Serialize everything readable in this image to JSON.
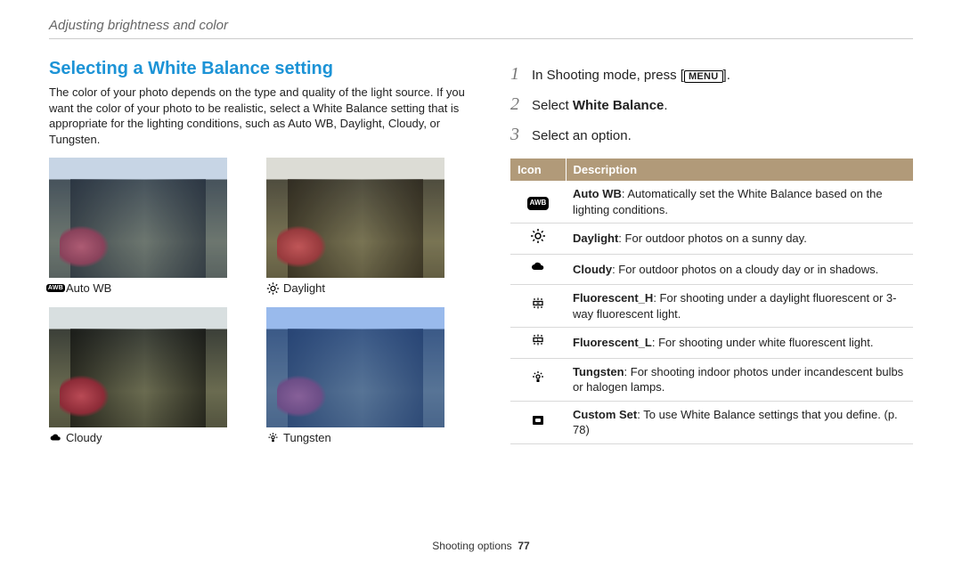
{
  "chapter": "Adjusting brightness and color",
  "left": {
    "heading": "Selecting a White Balance setting",
    "body": "The color of your photo depends on the type and quality of the light source. If you want the color of your photo to be realistic, select a White Balance setting that is appropriate for the lighting conditions, such as Auto WB, Daylight, Cloudy, or Tungsten.",
    "tiles": [
      {
        "icon": "awb",
        "label": "Auto WB"
      },
      {
        "icon": "sun",
        "label": "Daylight"
      },
      {
        "icon": "cloud",
        "label": "Cloudy"
      },
      {
        "icon": "tungsten",
        "label": "Tungsten"
      }
    ]
  },
  "right": {
    "steps": [
      {
        "num": "1",
        "pre": "In Shooting mode, press [",
        "btn": "MENU",
        "post": "]."
      },
      {
        "num": "2",
        "pre": "Select ",
        "bold": "White Balance",
        "post": "."
      },
      {
        "num": "3",
        "pre": "Select an option.",
        "bold": "",
        "post": ""
      }
    ],
    "table": {
      "headers": [
        "Icon",
        "Description"
      ],
      "rows": [
        {
          "icon": "awb",
          "bold": "Auto WB",
          "text": ": Automatically set the White Balance based on the lighting conditions."
        },
        {
          "icon": "sun",
          "bold": "Daylight",
          "text": ": For outdoor photos on a sunny day."
        },
        {
          "icon": "cloud",
          "bold": "Cloudy",
          "text": ": For outdoor photos on a cloudy day or in shadows."
        },
        {
          "icon": "fluoH",
          "bold": "Fluorescent_H",
          "text": ": For shooting under a daylight fluorescent or 3-way fluorescent light."
        },
        {
          "icon": "fluoL",
          "bold": "Fluorescent_L",
          "text": ": For shooting under white fluorescent light."
        },
        {
          "icon": "tungsten",
          "bold": "Tungsten",
          "text": ": For shooting indoor photos under incandescent bulbs or halogen lamps."
        },
        {
          "icon": "custom",
          "bold": "Custom Set",
          "text": ": To use White Balance settings that you define. (p. 78)"
        }
      ]
    }
  },
  "footer": {
    "section": "Shooting options",
    "page": "77"
  }
}
